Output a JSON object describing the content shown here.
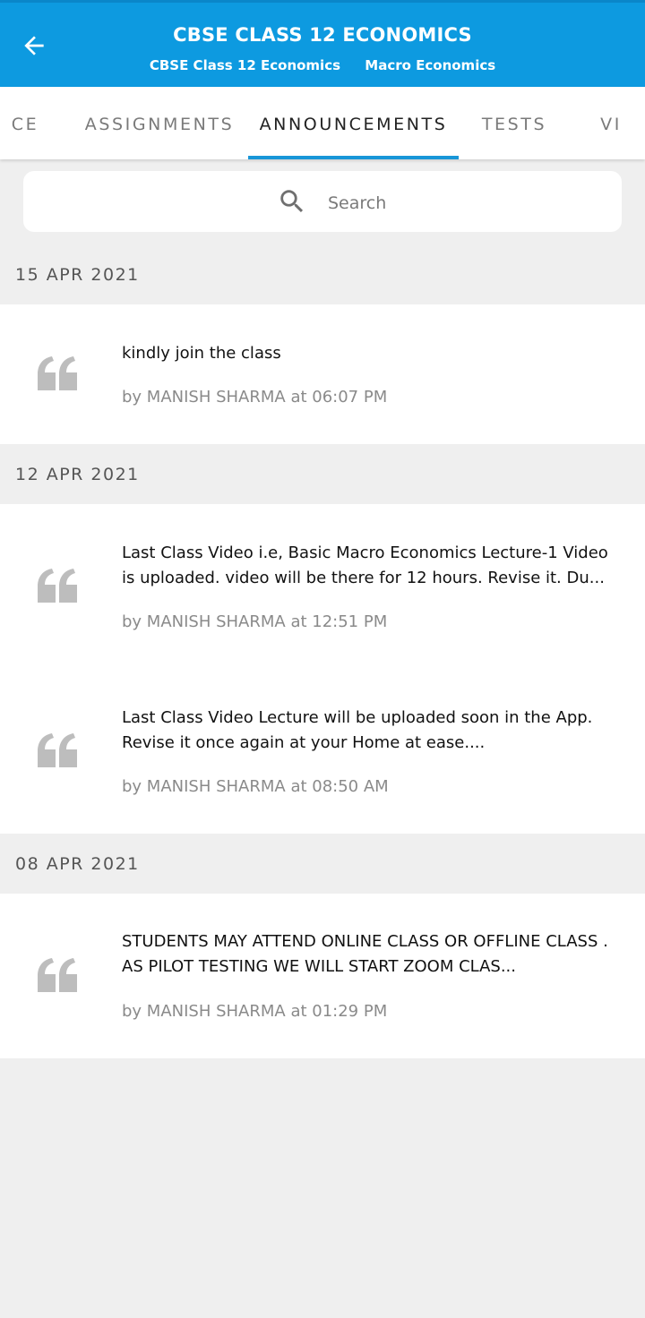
{
  "header": {
    "title": "CBSE CLASS 12 ECONOMICS",
    "subtitle_class": "CBSE Class 12 Economics",
    "subtitle_subject": "Macro Economics",
    "back_icon": "arrow-left-icon",
    "bar_color": "#0d9ae0"
  },
  "tabs": [
    {
      "label": "CE"
    },
    {
      "label": "ASSIGNMENTS"
    },
    {
      "label": "ANNOUNCEMENTS",
      "active": true
    },
    {
      "label": "TESTS"
    },
    {
      "label": "VI"
    }
  ],
  "search": {
    "placeholder": "Search",
    "icon": "search-icon"
  },
  "groups": [
    {
      "date": "15 APR 2021",
      "items": [
        {
          "text": "kindly join the class",
          "meta": "by MANISH SHARMA at 06:07 PM",
          "icon": "quote-icon"
        }
      ]
    },
    {
      "date": "12 APR 2021",
      "items": [
        {
          "text": "Last Class Video i.e, Basic Macro Economics Lecture-1 Video is uploaded. video will be there for 12 hours. Revise it. Du...",
          "meta": "by MANISH SHARMA at 12:51 PM",
          "icon": "quote-icon"
        },
        {
          "text": "Last Class Video Lecture will be uploaded soon in the App. Revise it once again at your Home at ease....",
          "meta": "by MANISH SHARMA at 08:50 AM",
          "icon": "quote-icon"
        }
      ]
    },
    {
      "date": "08 APR 2021",
      "items": [
        {
          "text": "STUDENTS MAY ATTEND ONLINE CLASS OR OFFLINE CLASS . AS PILOT TESTING WE WILL START ZOOM CLAS...",
          "meta": "by MANISH SHARMA at 01:29 PM",
          "icon": "quote-icon"
        }
      ]
    }
  ],
  "colors": {
    "accent": "#1896d8",
    "background": "#efefef",
    "quote_icon": "#bdbdbd"
  }
}
